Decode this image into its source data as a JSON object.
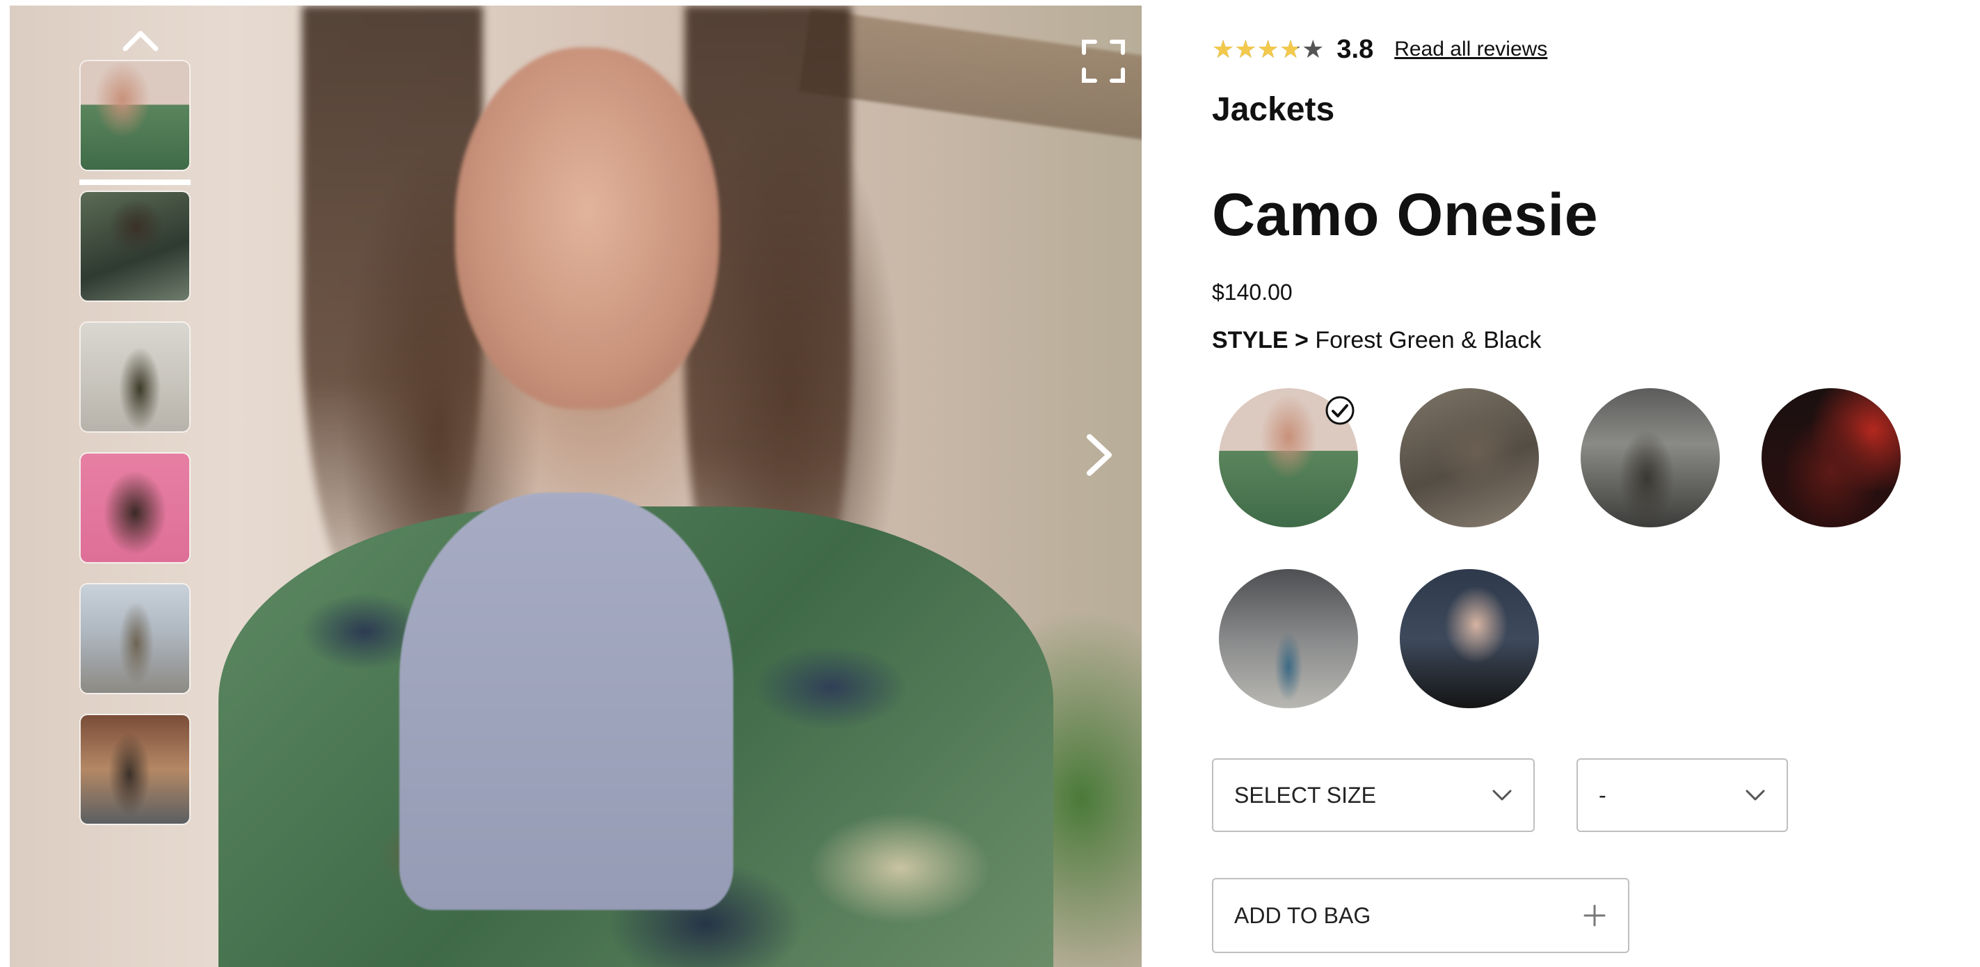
{
  "product": {
    "rating": "3.8",
    "rating_value": 3.8,
    "rating_max": 5,
    "reviews_link": "Read all reviews",
    "category": "Jackets",
    "title": "Camo Onesie",
    "price": "$140.00",
    "style_label": "STYLE >",
    "style_value": "Forest Green & Black"
  },
  "gallery": {
    "thumbnail_count": 6,
    "active_thumbnail": 1
  },
  "swatches": {
    "count": 6,
    "selected": 1
  },
  "selectors": {
    "size_value": "SELECT SIZE",
    "qty_value": "-"
  },
  "actions": {
    "add_to_bag": "ADD TO BAG"
  },
  "icons": {
    "up": "chevron-up-icon",
    "next": "chevron-right-icon",
    "fullscreen": "fullscreen-icon",
    "check": "checkmark-icon",
    "dropdown": "chevron-down-icon",
    "add": "plus-icon",
    "star": "star-icon"
  },
  "colors": {
    "star_fill": "#f2c94c",
    "star_empty": "#555555",
    "border": "#bfbfbf"
  }
}
